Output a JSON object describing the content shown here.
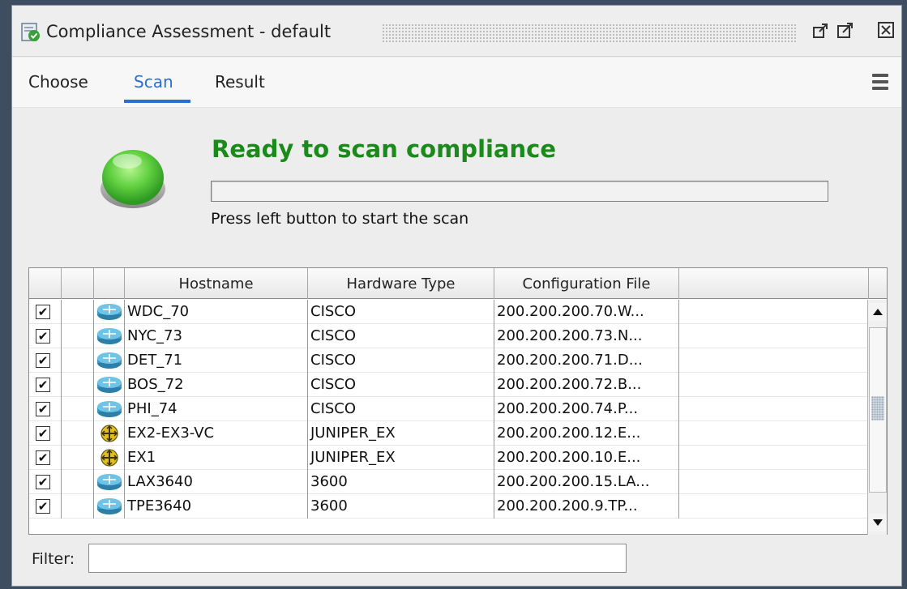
{
  "window": {
    "title": "Compliance Assessment - default",
    "buttons": [
      "restore-icon",
      "maximize-icon",
      "close-icon"
    ]
  },
  "tabs": [
    {
      "label": "Choose",
      "active": false
    },
    {
      "label": "Scan",
      "active": true
    },
    {
      "label": "Result",
      "active": false
    }
  ],
  "scan": {
    "title": "Ready to scan compliance",
    "hint": "Press left button to start the scan",
    "progress": 0,
    "title_color": "#1a8a1a",
    "button_color": "#5fcf3f"
  },
  "table": {
    "columns": [
      "",
      "",
      "",
      "Hostname",
      "Hardware Type",
      "Configuration File",
      ""
    ],
    "rows": [
      {
        "checked": true,
        "icon": "router-icon",
        "hostname": "WDC_70",
        "hardware": "CISCO",
        "config": "200.200.200.70.W..."
      },
      {
        "checked": true,
        "icon": "router-icon",
        "hostname": "NYC_73",
        "hardware": "CISCO",
        "config": "200.200.200.73.N..."
      },
      {
        "checked": true,
        "icon": "router-icon",
        "hostname": "DET_71",
        "hardware": "CISCO",
        "config": "200.200.200.71.D..."
      },
      {
        "checked": true,
        "icon": "router-icon",
        "hostname": "BOS_72",
        "hardware": "CISCO",
        "config": "200.200.200.72.B..."
      },
      {
        "checked": true,
        "icon": "router-icon",
        "hostname": "PHI_74",
        "hardware": "CISCO",
        "config": "200.200.200.74.P..."
      },
      {
        "checked": true,
        "icon": "switch-icon",
        "hostname": "EX2-EX3-VC",
        "hardware": "JUNIPER_EX",
        "config": "200.200.200.12.E..."
      },
      {
        "checked": true,
        "icon": "switch-icon",
        "hostname": "EX1",
        "hardware": "JUNIPER_EX",
        "config": "200.200.200.10.E..."
      },
      {
        "checked": true,
        "icon": "router-icon",
        "hostname": "LAX3640",
        "hardware": "3600",
        "config": "200.200.200.15.LA..."
      },
      {
        "checked": true,
        "icon": "router-icon",
        "hostname": "TPE3640",
        "hardware": "3600",
        "config": "200.200.200.9.TP..."
      }
    ]
  },
  "filter": {
    "label": "Filter:",
    "value": ""
  }
}
